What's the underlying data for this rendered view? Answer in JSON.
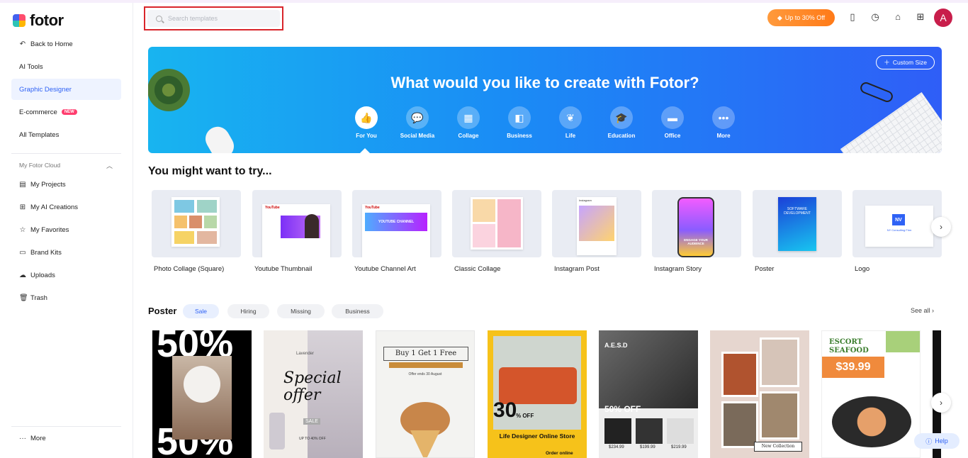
{
  "brand": {
    "name": "fotor"
  },
  "sidebar": {
    "back": "Back to Home",
    "items": [
      {
        "label": "AI Tools"
      },
      {
        "label": "Graphic Designer",
        "active": true
      },
      {
        "label": "E-commerce",
        "badge": "NEW"
      },
      {
        "label": "All Templates"
      }
    ],
    "cloud_title": "My Fotor Cloud",
    "cloud_items": [
      {
        "label": "My Projects",
        "icon": "document-icon"
      },
      {
        "label": "My AI Creations",
        "icon": "ai-creations-icon"
      },
      {
        "label": "My Favorites",
        "icon": "star-icon"
      },
      {
        "label": "Brand Kits",
        "icon": "brand-kit-icon"
      },
      {
        "label": "Uploads",
        "icon": "upload-icon"
      },
      {
        "label": "Trash",
        "icon": "trash-icon"
      }
    ],
    "more": "More"
  },
  "topbar": {
    "search_placeholder": "Search templates",
    "promo": "Up to 30% Off",
    "avatar_initial": "A"
  },
  "banner": {
    "title": "What would you like to create with Fotor?",
    "custom_size": "Custom Size",
    "categories": [
      {
        "label": "For You",
        "icon": "thumbs-up-icon",
        "active": true
      },
      {
        "label": "Social Media",
        "icon": "chat-icon"
      },
      {
        "label": "Collage",
        "icon": "collage-icon"
      },
      {
        "label": "Business",
        "icon": "business-icon"
      },
      {
        "label": "Life",
        "icon": "leaf-icon"
      },
      {
        "label": "Education",
        "icon": "graduation-cap-icon"
      },
      {
        "label": "Office",
        "icon": "folder-icon"
      },
      {
        "label": "More",
        "icon": "more-dots-icon"
      }
    ]
  },
  "try_section": {
    "title": "You might want to try...",
    "cards": [
      {
        "label": "Photo Collage (Square)"
      },
      {
        "label": "Youtube Thumbnail"
      },
      {
        "label": "Youtube Channel Art"
      },
      {
        "label": "Classic Collage"
      },
      {
        "label": "Instagram Post"
      },
      {
        "label": "Instagram Story"
      },
      {
        "label": "Poster"
      },
      {
        "label": "Logo"
      }
    ],
    "thumb_texts": {
      "youtube": "YouTube",
      "youtube_channel": "YOUTUBE CHANNEL",
      "instagram": "Instagram",
      "story": "ENGAGE YOUR AUDIENCE",
      "poster": "SOFTWARE DEVELOPMENT",
      "logo_mark": "NV",
      "logo_sub": "NY Consulting Firm"
    }
  },
  "poster_section": {
    "title": "Poster",
    "chips": [
      "Sale",
      "Hiring",
      "Missing",
      "Business"
    ],
    "see_all": "See all",
    "posters": [
      {
        "text1": "50%"
      },
      {
        "text1": "Special offer",
        "text2": "Lavender",
        "text3": "SALE",
        "text4": "UP TO 40% OFF"
      },
      {
        "text1": "Buy 1 Get 1 Free",
        "text2": "Offer ends 30 August"
      },
      {
        "text1": "30",
        "text2": "% OFF",
        "text3": "Life Designer Online Store",
        "text4": "Order online"
      },
      {
        "text1": "A.E.S.D",
        "text2": "50% OFF",
        "prices": [
          "$234.99",
          "$199.99",
          "$219.99"
        ]
      },
      {
        "text1": "New Collection"
      },
      {
        "text1": "ESCORT SEAFOOD",
        "text2": "$39.99"
      }
    ]
  },
  "help": "Help"
}
